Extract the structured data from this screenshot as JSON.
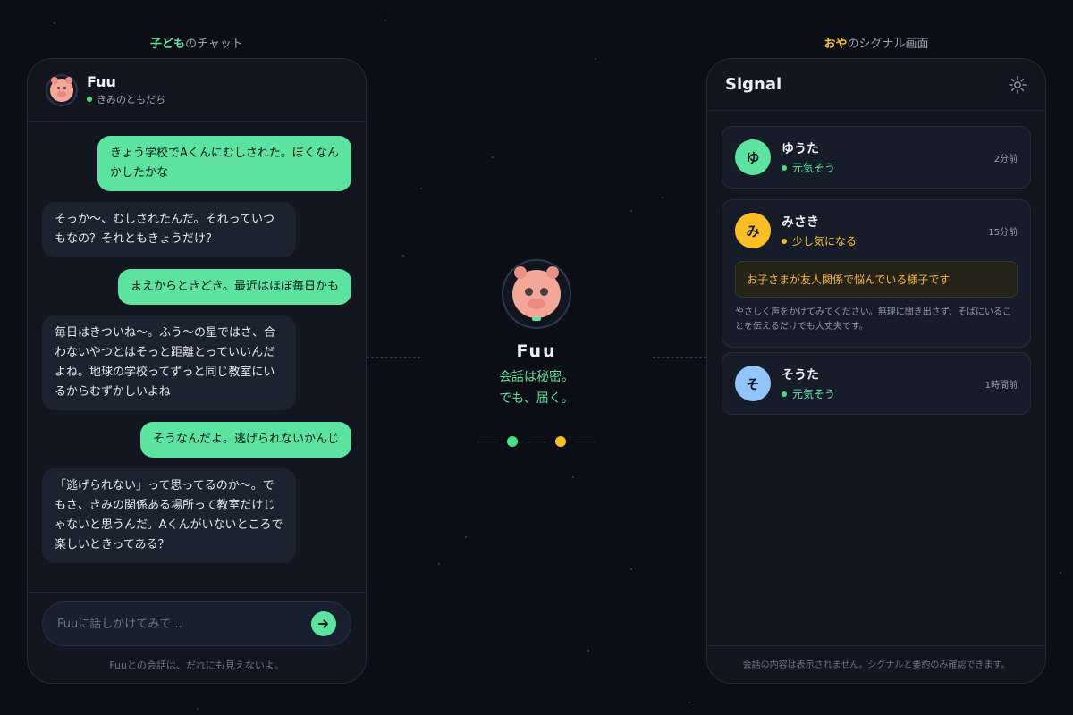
{
  "captions": {
    "left_highlight": "子ども",
    "left_rest": "のチャット",
    "right_highlight": "おや",
    "right_rest": "のシグナル画面"
  },
  "colors": {
    "accent_green": "#5ce3a0",
    "accent_yellow": "#fbbf24",
    "background": "#0b0e15",
    "panel": "#111621"
  },
  "chat": {
    "name": "Fuu",
    "subtitle": "きみのともだち",
    "messages": [
      {
        "from": "me",
        "text": "きょう学校でAくんにむしされた。ぼくなんかしたかな"
      },
      {
        "from": "fuu",
        "text": "そっか〜、むしされたんだ。それっていつもなの？それともきょうだけ？"
      },
      {
        "from": "me",
        "text": "まえからときどき。最近はほぼ毎日かも"
      },
      {
        "from": "fuu",
        "text": "毎日はきついね〜。ふう〜の星ではさ、合わないやつとはそっと距離とっていいんだよね。地球の学校ってずっと同じ教室にいるからむずかしいよね"
      },
      {
        "from": "me",
        "text": "そうなんだよ。逃げられないかんじ"
      },
      {
        "from": "fuu",
        "text": "「逃げられない」って思ってるのか〜。でもさ、きみの関係ある場所って教室だけじゃないと思うんだ。Aくんがいないところで楽しいときってある？"
      }
    ],
    "input_placeholder": "Fuuに話しかけてみて...",
    "send_icon": "arrow-right-icon",
    "footer_note": "Fuuとの会話は、だれにも見えないよ。"
  },
  "center": {
    "name": "Fuu",
    "line1": "会話は秘密。",
    "line2": "でも、届く。"
  },
  "signal": {
    "title": "Signal",
    "settings_icon": "gear-icon",
    "children": [
      {
        "initial": "ゆ",
        "name": "ゆうた",
        "status": "元気そう",
        "status_color": "#4ade80",
        "avatar_color": "#5ce3a0",
        "time": "2分前"
      },
      {
        "initial": "み",
        "name": "みさき",
        "status": "少し気になる",
        "status_color": "#fbbf24",
        "avatar_color": "#fbbf24",
        "time": "15分前",
        "alert": "お子さまが友人関係で悩んでいる様子です",
        "advice": "やさしく声をかけてみてください。無理に聞き出さず、そばにいることを伝えるだけでも大丈夫です。"
      },
      {
        "initial": "そ",
        "name": "そうた",
        "status": "元気そう",
        "status_color": "#4ade80",
        "avatar_color": "#93c5fd",
        "time": "1時間前"
      }
    ],
    "footer_note": "会話の内容は表示されません。シグナルと要約のみ確認できます。"
  }
}
